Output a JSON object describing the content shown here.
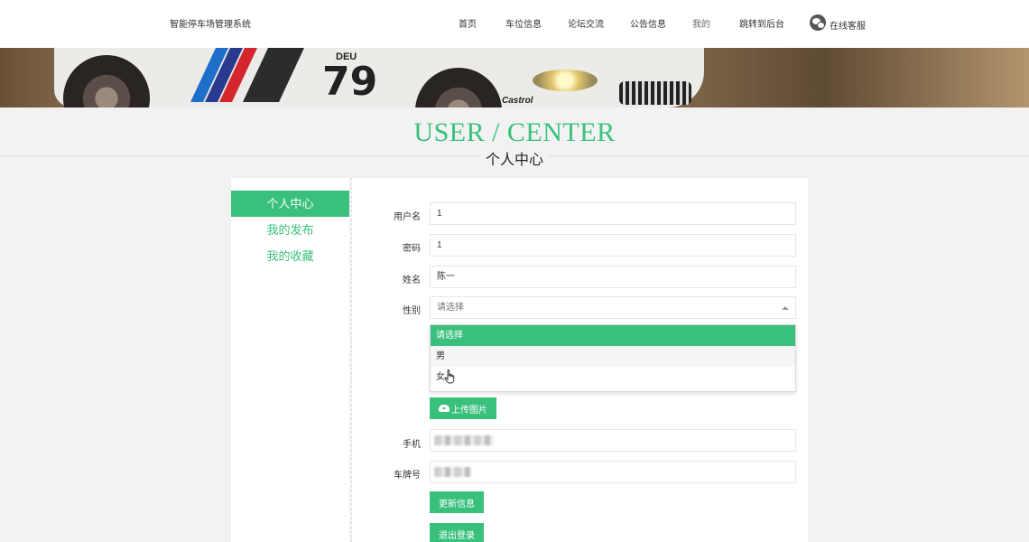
{
  "header": {
    "brand": "智能停车场管理系统",
    "nav": [
      "首页",
      "车位信息",
      "论坛交流",
      "公告信息",
      "我的",
      "跳转到后台"
    ],
    "service_label": "在线客服"
  },
  "banner": {
    "car_number": "79",
    "deu": "DEU",
    "castrol": "Castrol"
  },
  "page_title": {
    "en": "USER / CENTER",
    "zh": "个人中心"
  },
  "sidebar": {
    "items": [
      "个人中心",
      "我的发布",
      "我的收藏"
    ],
    "active_index": 0
  },
  "form": {
    "username_label": "用户名",
    "username_value": "1",
    "password_label": "密码",
    "password_value": "1",
    "name_label": "姓名",
    "name_value": "陈一",
    "gender_label": "性别",
    "gender_placeholder": "请选择",
    "gender_options": [
      "请选择",
      "男",
      "女"
    ],
    "upload_label": "上传图片",
    "phone_label": "手机",
    "plate_label": "车牌号",
    "update_label": "更新信息",
    "logout_label": "退出登录"
  },
  "colors": {
    "accent": "#3ac07d",
    "background": "#f2f2f2"
  }
}
